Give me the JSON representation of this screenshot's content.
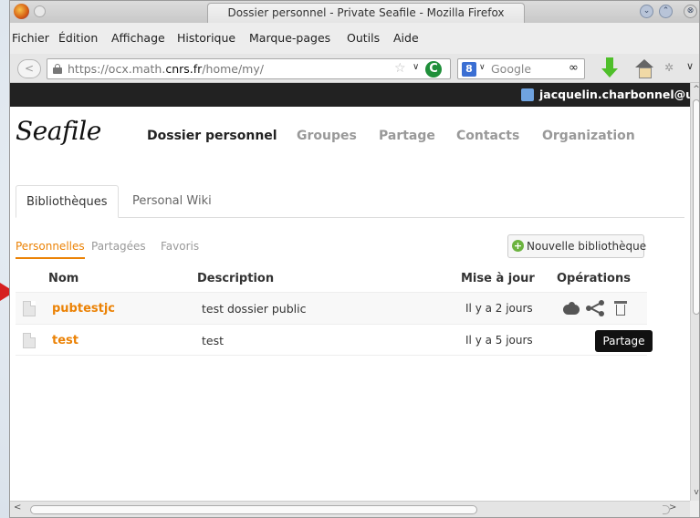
{
  "window": {
    "title": "Dossier personnel - Private Seafile - Mozilla Firefox",
    "minimize_glyph": "⌄",
    "maximize_glyph": "⌃",
    "close_glyph": "⊗"
  },
  "menubar": {
    "items": [
      "Fichier",
      "Édition",
      "Affichage",
      "Historique",
      "Marque-pages",
      "Outils",
      "Aide"
    ]
  },
  "navbar": {
    "back_glyph": "<",
    "url_prefix": "https://ocx.math.",
    "url_domain": "cnrs.fr",
    "url_suffix": "/home/my/",
    "star_glyph": "☆",
    "drop_glyph": "∨",
    "reload_glyph": "C",
    "search_engine_glyph": "8",
    "search_drop_glyph": "∨",
    "search_placeholder": "Google",
    "binoculars_glyph": "∞",
    "puzzle_glyph": "✲",
    "more_glyph": "∨"
  },
  "topbar": {
    "user": "jacquelin.charbonnel@u"
  },
  "app": {
    "logo": "Seafile",
    "nav": [
      "Dossier personnel",
      "Groupes",
      "Partage",
      "Contacts",
      "Organization"
    ],
    "nav_active": 0
  },
  "tabs": {
    "items": [
      "Bibliothèques",
      "Personal Wiki"
    ],
    "active": 0
  },
  "subnav": {
    "items": [
      "Personnelles",
      "Partagées",
      "Favoris"
    ],
    "active": 0
  },
  "new_library_button": {
    "icon_glyph": "+",
    "label": "Nouvelle bibliothèque"
  },
  "table": {
    "headers": [
      "Nom",
      "Description",
      "Mise à jour",
      "Opérations"
    ],
    "rows": [
      {
        "name": "pubtestjc",
        "description": "test dossier public",
        "updated": "Il y a 2 jours"
      },
      {
        "name": "test",
        "description": "test",
        "updated": "Il y a 5 jours"
      }
    ]
  },
  "tooltip": {
    "text": "Partage"
  },
  "scroll": {
    "up_glyph": "^",
    "down_glyph": "v",
    "left_glyph": "<",
    "right_glyph": ">"
  },
  "colors": {
    "accent": "#eb8205",
    "topbar": "#222222",
    "arrow": "#d62020"
  }
}
